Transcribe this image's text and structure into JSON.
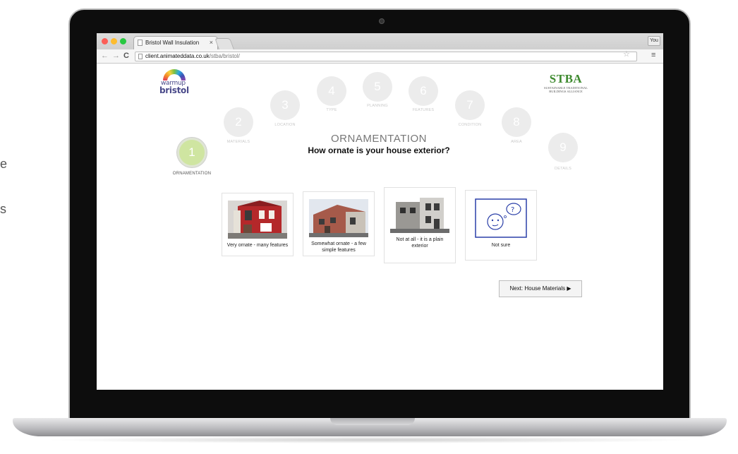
{
  "side_fragments": [
    "e",
    "s"
  ],
  "browser": {
    "tab_title": "Bristol Wall Insulation",
    "tab_close": "×",
    "user_button": "You",
    "url_host": "client.animateddata.co.uk",
    "url_path": "/stba/bristol/",
    "back": "←",
    "forward": "→",
    "reload": "C",
    "star": "☆",
    "menu": "≡"
  },
  "logo": {
    "line1": "warmup",
    "line2": "bristol"
  },
  "stba": {
    "title": "STBA",
    "subtitle_line1": "SUSTAINABLE TRADITIONAL",
    "subtitle_line2": "BUILDINGS ALLIANCE"
  },
  "steps": [
    {
      "number": "1",
      "label": "ORNAMENTATION",
      "active": true
    },
    {
      "number": "2",
      "label": "MATERIALS",
      "active": false
    },
    {
      "number": "3",
      "label": "LOCATION",
      "active": false
    },
    {
      "number": "4",
      "label": "TYPE",
      "active": false
    },
    {
      "number": "5",
      "label": "PLANNING",
      "active": false
    },
    {
      "number": "6",
      "label": "FEATURES",
      "active": false
    },
    {
      "number": "7",
      "label": "CONDITION",
      "active": false
    },
    {
      "number": "8",
      "label": "AREA",
      "active": false
    },
    {
      "number": "9",
      "label": "DETAILS",
      "active": false
    }
  ],
  "main": {
    "heading": "ORNAMENTATION",
    "question": "How ornate is your house exterior?"
  },
  "options": [
    {
      "caption": "Very ornate - many features"
    },
    {
      "caption": "Somewhat ornate - a few simple features"
    },
    {
      "caption": "Not at all - it is a plain exterior"
    },
    {
      "caption": "Not sure"
    }
  ],
  "next_button": "Next: House Materials ▶",
  "colors": {
    "active_step": "#cfe5a1",
    "inactive_step": "#ececec",
    "stba_green": "#3e8a2f"
  }
}
